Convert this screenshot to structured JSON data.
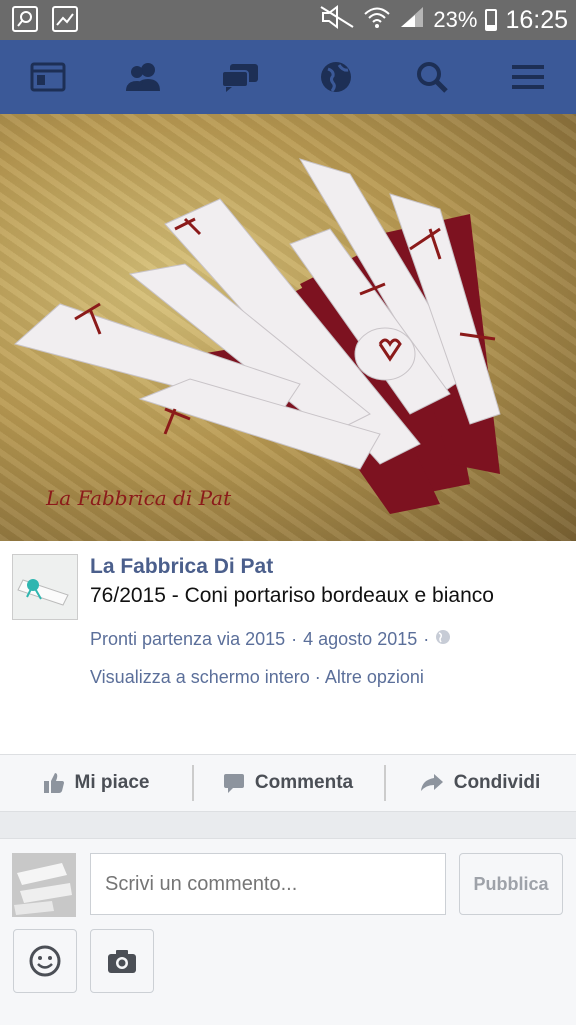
{
  "status_bar": {
    "battery": "23%",
    "time": "16:25"
  },
  "nav": {
    "icons": [
      "news-feed-icon",
      "friends-icon",
      "messages-icon",
      "notifications-globe-icon",
      "search-icon",
      "menu-icon"
    ]
  },
  "photo": {
    "watermark": "La Fabbrica di Pat"
  },
  "post": {
    "page_name": "La Fabbrica Di Pat",
    "caption": "76/2015 - Coni portariso bordeaux e bianco",
    "album": "Pronti partenza via 2015",
    "separator": "·",
    "date": "4 agosto 2015",
    "fullscreen": "Visualizza a schermo intero",
    "more_options": "Altre opzioni"
  },
  "actions": {
    "like": "Mi piace",
    "comment": "Commenta",
    "share": "Condividi"
  },
  "comment_box": {
    "placeholder": "Scrivi un commento...",
    "publish": "Pubblica"
  },
  "colors": {
    "brand": "#3b5998",
    "link": "#5b6f9a",
    "status_bar": "#6b6b6b"
  }
}
